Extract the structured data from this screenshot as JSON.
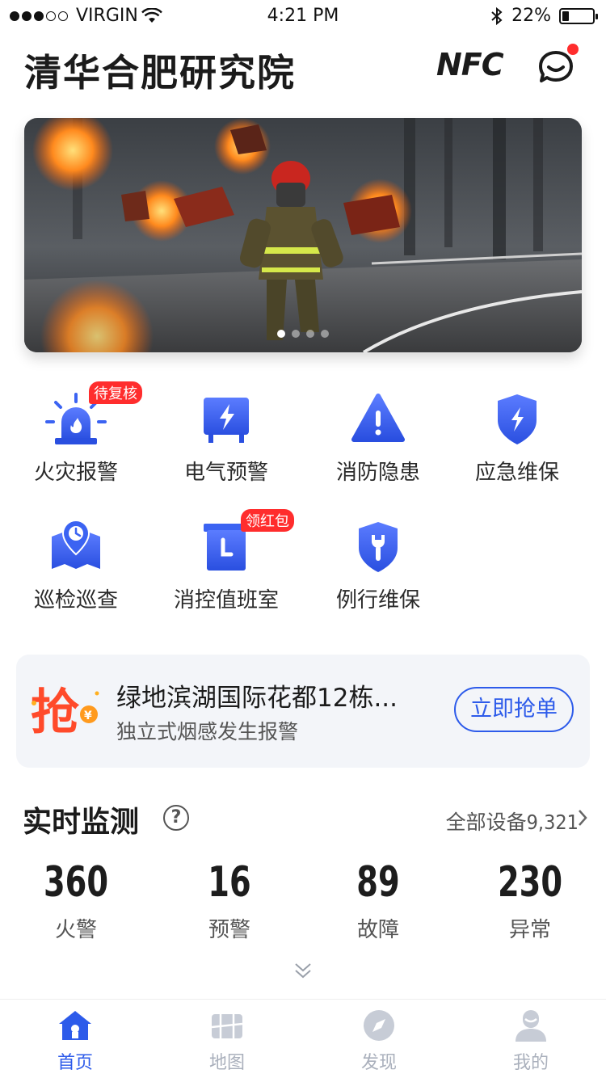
{
  "status_bar": {
    "carrier": "VIRGIN",
    "time": "4:21 PM",
    "battery": "22%",
    "battery_level": 0.22
  },
  "header": {
    "title": "清华合肥研究院",
    "nfc_label": "NFC",
    "message_icon": "chat-smile-icon",
    "has_unread": true
  },
  "banner": {
    "page_count": 4,
    "active_index": 0
  },
  "grid": {
    "items": [
      {
        "label": "火灾报警",
        "icon": "alarm-light-icon",
        "tag": "待复核"
      },
      {
        "label": "电气预警",
        "icon": "electric-box-icon",
        "tag": ""
      },
      {
        "label": "消防隐患",
        "icon": "warning-triangle-icon",
        "tag": ""
      },
      {
        "label": "应急维保",
        "icon": "shield-bolt-icon",
        "tag": ""
      },
      {
        "label": "巡检巡查",
        "icon": "map-clock-icon",
        "tag": ""
      },
      {
        "label": "消控值班室",
        "icon": "duty-room-clock-icon",
        "tag": "领红包"
      },
      {
        "label": "例行维保",
        "icon": "shield-wrench-icon",
        "tag": ""
      }
    ]
  },
  "promo": {
    "logo_text": "抢",
    "title": "绿地滨湖国际花都12栋...",
    "subtitle": "独立式烟感发生报警",
    "button": "立即抢单"
  },
  "realtime": {
    "title": "实时监测",
    "all_devices_label": "全部设备",
    "all_devices_count": "9,321",
    "stats": [
      {
        "value": "360",
        "label": "火警"
      },
      {
        "value": "16",
        "label": "预警"
      },
      {
        "value": "89",
        "label": "故障"
      },
      {
        "value": "230",
        "label": "异常"
      }
    ]
  },
  "tabbar": {
    "tabs": [
      {
        "label": "首页",
        "icon": "home-icon",
        "active": true
      },
      {
        "label": "地图",
        "icon": "map-icon",
        "active": false
      },
      {
        "label": "发现",
        "icon": "compass-icon",
        "active": false
      },
      {
        "label": "我的",
        "icon": "profile-icon",
        "active": false
      }
    ]
  },
  "colors": {
    "accent": "#2d5bea",
    "badge_red": "#ff2d2d",
    "icon_gradient_top": "#5b7cff",
    "icon_gradient_bottom": "#2a4fe0"
  }
}
